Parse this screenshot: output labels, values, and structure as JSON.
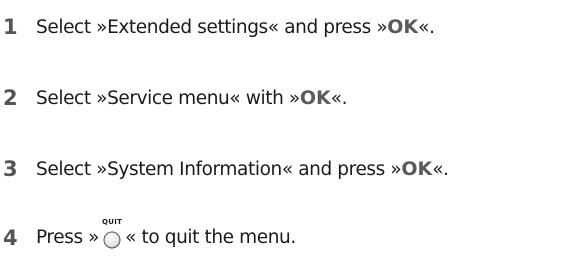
{
  "steps": [
    {
      "number": "1",
      "pre": "Select »Extended settings« and press »",
      "ok": "OK",
      "post": "«."
    },
    {
      "number": "2",
      "pre": "Select »Service menu« with  »",
      "ok": "OK",
      "post": "«."
    },
    {
      "number": "3",
      "pre": "Select »System Information« and press »",
      "ok": "OK",
      "post": "«."
    },
    {
      "number": "4",
      "pre": "Press »",
      "button_label": "QUIT",
      "button_icon": "quit-button-icon",
      "post": "« to quit the menu."
    }
  ]
}
